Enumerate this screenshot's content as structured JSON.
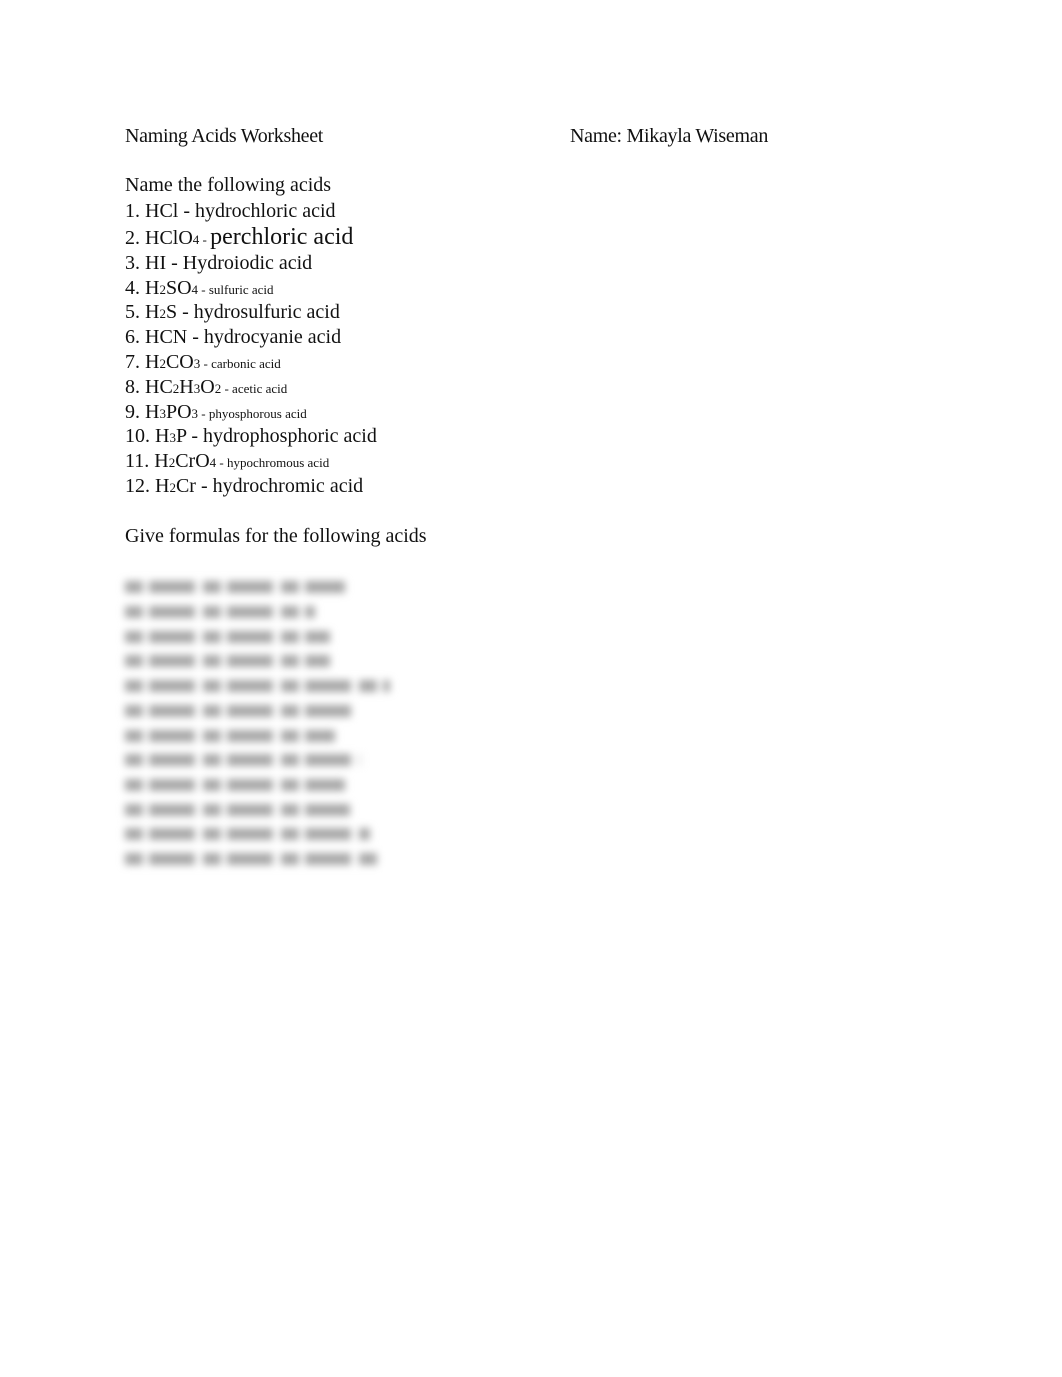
{
  "header": {
    "title": "Naming Acids Worksheet",
    "name_label": "Name: Mikayla Wiseman"
  },
  "section1": {
    "title": "Name the following acids",
    "items": [
      {
        "num": "1.",
        "formula": [
          {
            "t": "HCl"
          }
        ],
        "sep": " - ",
        "answer": "hydrochloric acid",
        "style": "normal"
      },
      {
        "num": "2.",
        "formula": [
          {
            "t": "HClO"
          },
          {
            "s": "4"
          }
        ],
        "sep": " - ",
        "answer": "perchloric acid",
        "style": "big"
      },
      {
        "num": "3.",
        "formula": [
          {
            "t": "HI"
          }
        ],
        "sep": " - ",
        "answer": "Hydroiodic acid",
        "style": "normal"
      },
      {
        "num": "4.",
        "formula": [
          {
            "t": "H"
          },
          {
            "s": "2"
          },
          {
            "t": "SO"
          },
          {
            "s": "4"
          }
        ],
        "sep": " - ",
        "answer": "sulfuric acid",
        "style": "small"
      },
      {
        "num": "5.",
        "formula": [
          {
            "t": "H"
          },
          {
            "s": "2"
          },
          {
            "t": "S"
          }
        ],
        "sep": " - ",
        "answer": "hydrosulfuric acid",
        "style": "normal"
      },
      {
        "num": "6.",
        "formula": [
          {
            "t": "HCN"
          }
        ],
        "sep": " - ",
        "answer": "hydrocyanie acid",
        "style": "normal"
      },
      {
        "num": "7.",
        "formula": [
          {
            "t": "H"
          },
          {
            "s": "2"
          },
          {
            "t": "CO"
          },
          {
            "s": "3"
          }
        ],
        "sep": " - ",
        "answer": "carbonic acid",
        "style": "small"
      },
      {
        "num": "8.",
        "formula": [
          {
            "t": "HC"
          },
          {
            "s": "2"
          },
          {
            "t": "H"
          },
          {
            "s": "3"
          },
          {
            "t": "O"
          },
          {
            "s": "2"
          }
        ],
        "sep": " - ",
        "answer": "acetic acid",
        "style": "small"
      },
      {
        "num": "9.",
        "formula": [
          {
            "t": "H"
          },
          {
            "s": "3"
          },
          {
            "t": "PO"
          },
          {
            "s": "3"
          }
        ],
        "sep": " - ",
        "answer": "phyosphorous acid",
        "style": "small"
      },
      {
        "num": "10.",
        "formula": [
          {
            "t": "H"
          },
          {
            "s": "3"
          },
          {
            "t": "P"
          }
        ],
        "sep": " - ",
        "answer": "hydrophosphoric acid",
        "style": "normal"
      },
      {
        "num": "11.",
        "formula": [
          {
            "t": "H"
          },
          {
            "s": "2"
          },
          {
            "t": "CrO"
          },
          {
            "s": "4"
          }
        ],
        "sep": " - ",
        "answer": "hypochromous acid",
        "style": "small"
      },
      {
        "num": "12.",
        "formula": [
          {
            "t": "H"
          },
          {
            "s": "2"
          },
          {
            "t": "Cr"
          }
        ],
        "sep": " - ",
        "answer": "hydrochromic acid",
        "style": "normal"
      }
    ]
  },
  "section2": {
    "title": "Give formulas for the following acids",
    "blurred_line_count": 12
  }
}
